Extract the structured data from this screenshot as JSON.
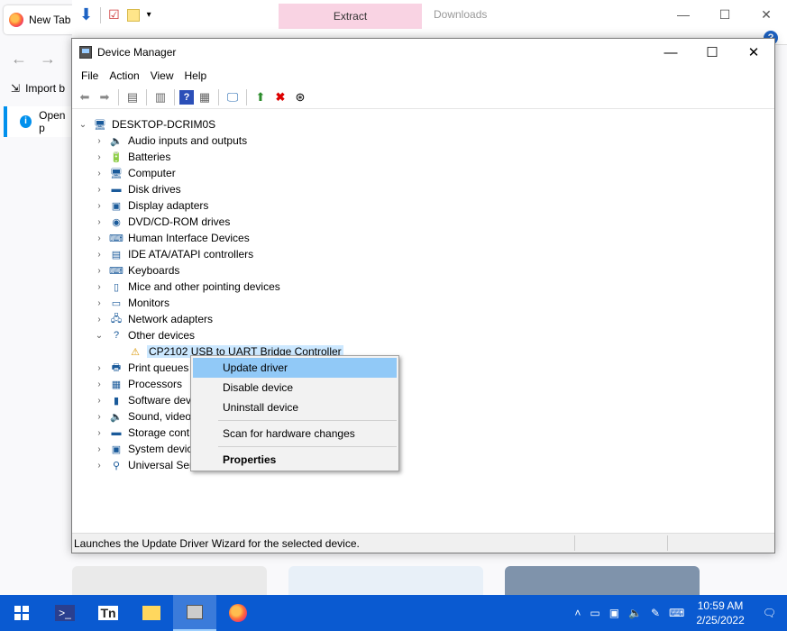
{
  "firefox": {
    "tab_label": "New Tab",
    "import_label": "Import b",
    "open_label": "Open p"
  },
  "explorer": {
    "extract_label": "Extract",
    "downloads_label": "Downloads"
  },
  "device_manager": {
    "title": "Device Manager",
    "menu": [
      "File",
      "Action",
      "View",
      "Help"
    ],
    "root": "DESKTOP-DCRIM0S",
    "categories": [
      {
        "label": "Audio inputs and outputs",
        "icon": "speaker-icon",
        "glyph": "🔈"
      },
      {
        "label": "Batteries",
        "icon": "battery-icon",
        "glyph": "🔋"
      },
      {
        "label": "Computer",
        "icon": "computer-icon",
        "glyph": "🖥"
      },
      {
        "label": "Disk drives",
        "icon": "disk-icon",
        "glyph": "▬"
      },
      {
        "label": "Display adapters",
        "icon": "display-adapter-icon",
        "glyph": "▣"
      },
      {
        "label": "DVD/CD-ROM drives",
        "icon": "dvd-icon",
        "glyph": "◉"
      },
      {
        "label": "Human Interface Devices",
        "icon": "hid-icon",
        "glyph": "⌨"
      },
      {
        "label": "IDE ATA/ATAPI controllers",
        "icon": "ide-icon",
        "glyph": "▤"
      },
      {
        "label": "Keyboards",
        "icon": "keyboard-icon",
        "glyph": "⌨"
      },
      {
        "label": "Mice and other pointing devices",
        "icon": "mouse-icon",
        "glyph": "▯"
      },
      {
        "label": "Monitors",
        "icon": "monitor-icon",
        "glyph": "▭"
      },
      {
        "label": "Network adapters",
        "icon": "network-icon",
        "glyph": "🖧"
      },
      {
        "label": "Other devices",
        "icon": "other-devices-icon",
        "glyph": "?"
      }
    ],
    "child_device": "CP2102 USB to UART Bridge Controller",
    "categories_after": [
      {
        "label": "Print queues",
        "icon": "printer-icon",
        "glyph": "🖶"
      },
      {
        "label": "Processors",
        "icon": "processor-icon",
        "glyph": "▦"
      },
      {
        "label": "Software dev",
        "icon": "software-device-icon",
        "glyph": "▮"
      },
      {
        "label": "Sound, video",
        "icon": "sound-icon",
        "glyph": "🔈"
      },
      {
        "label": "Storage cont",
        "icon": "storage-icon",
        "glyph": "▬"
      },
      {
        "label": "System devic",
        "icon": "system-icon",
        "glyph": "▣"
      },
      {
        "label": "Universal Ser",
        "icon": "usb-icon",
        "glyph": "⚲"
      }
    ],
    "status": "Launches the Update Driver Wizard for the selected device."
  },
  "context_menu": {
    "update": "Update driver",
    "disable": "Disable device",
    "uninstall": "Uninstall device",
    "scan": "Scan for hardware changes",
    "properties": "Properties"
  },
  "taskbar": {
    "time": "10:59 AM",
    "date": "2/25/2022"
  },
  "colors": {
    "taskbar": "#0a5ad1",
    "selection": "#cce8ff",
    "menu_highlight": "#91c9f7",
    "extract_tab": "#f9d3e3"
  }
}
